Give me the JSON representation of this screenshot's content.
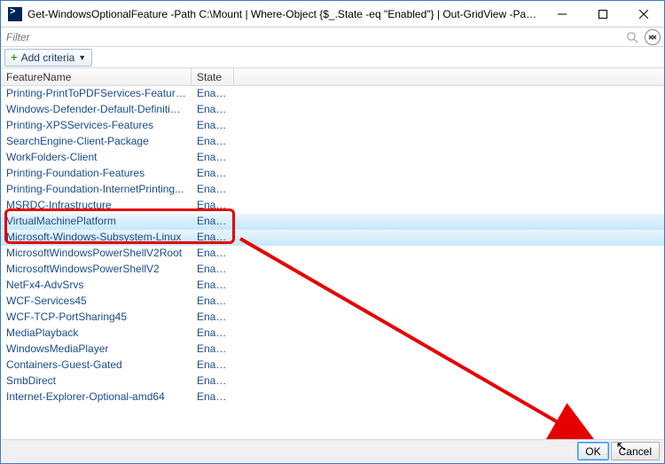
{
  "window": {
    "title": "Get-WindowsOptionalFeature -Path C:\\Mount | Where-Object {$_.State -eq \"Enabled\"} | Out-GridView -PassThru | Disable-WindowsOp..."
  },
  "filter": {
    "placeholder": "Filter"
  },
  "criteria": {
    "add_label": "Add criteria"
  },
  "grid": {
    "columns": {
      "feature": "FeatureName",
      "state": "State"
    },
    "rows": [
      {
        "name": "Printing-PrintToPDFServices-Features",
        "state": "Enabled",
        "selected": false
      },
      {
        "name": "Windows-Defender-Default-Definitions",
        "state": "Enabled",
        "selected": false
      },
      {
        "name": "Printing-XPSServices-Features",
        "state": "Enabled",
        "selected": false
      },
      {
        "name": "SearchEngine-Client-Package",
        "state": "Enabled",
        "selected": false
      },
      {
        "name": "WorkFolders-Client",
        "state": "Enabled",
        "selected": false
      },
      {
        "name": "Printing-Foundation-Features",
        "state": "Enabled",
        "selected": false
      },
      {
        "name": "Printing-Foundation-InternetPrinting...",
        "state": "Enabled",
        "selected": false
      },
      {
        "name": "MSRDC-Infrastructure",
        "state": "Enabled",
        "selected": false
      },
      {
        "name": "VirtualMachinePlatform",
        "state": "Enabled",
        "selected": true
      },
      {
        "name": "Microsoft-Windows-Subsystem-Linux",
        "state": "Enabled",
        "selected": true
      },
      {
        "name": "MicrosoftWindowsPowerShellV2Root",
        "state": "Enabled",
        "selected": false
      },
      {
        "name": "MicrosoftWindowsPowerShellV2",
        "state": "Enabled",
        "selected": false
      },
      {
        "name": "NetFx4-AdvSrvs",
        "state": "Enabled",
        "selected": false
      },
      {
        "name": "WCF-Services45",
        "state": "Enabled",
        "selected": false
      },
      {
        "name": "WCF-TCP-PortSharing45",
        "state": "Enabled",
        "selected": false
      },
      {
        "name": "MediaPlayback",
        "state": "Enabled",
        "selected": false
      },
      {
        "name": "WindowsMediaPlayer",
        "state": "Enabled",
        "selected": false
      },
      {
        "name": "Containers-Guest-Gated",
        "state": "Enabled",
        "selected": false
      },
      {
        "name": "SmbDirect",
        "state": "Enabled",
        "selected": false
      },
      {
        "name": "Internet-Explorer-Optional-amd64",
        "state": "Enabled",
        "selected": false
      }
    ]
  },
  "footer": {
    "ok": "OK",
    "cancel": "Cancel"
  }
}
